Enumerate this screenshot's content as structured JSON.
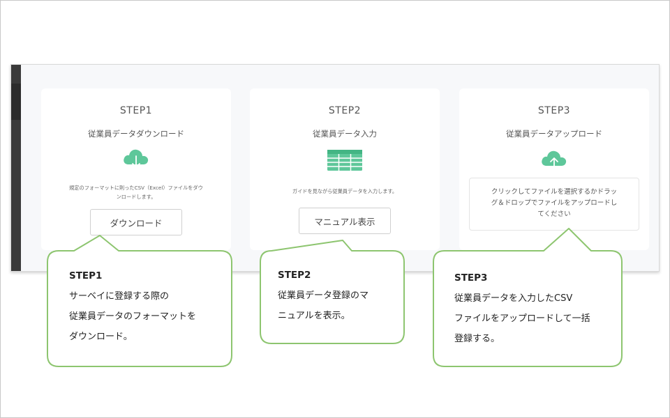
{
  "steps": [
    {
      "title": "STEP1",
      "subtitle": "従業員データダウンロード",
      "icon": "cloud-download-icon",
      "description_lines": [
        "規定のフォーマットに則ったCSV（Excel）ファイルをダウ",
        "ンロードします。"
      ],
      "button_label": "ダウンロード"
    },
    {
      "title": "STEP2",
      "subtitle": "従業員データ入力",
      "icon": "table-icon",
      "description_lines": [
        "ガイドを見ながら従業員データを入力します。"
      ],
      "button_label": "マニュアル表示"
    },
    {
      "title": "STEP3",
      "subtitle": "従業員データアップロード",
      "icon": "cloud-upload-icon",
      "dropzone_lines": [
        "クリックしてファイルを選択するかドラッ",
        "グ＆ドロップでファイルをアップロードし",
        "てください"
      ]
    }
  ],
  "callouts": [
    {
      "heading": "STEP1",
      "lines": [
        "サーベイに登録する際の",
        "従業員データのフォーマットを",
        "ダウンロード。"
      ]
    },
    {
      "heading": "STEP2",
      "lines": [
        "従業員データ登録のマ",
        "ニュアルを表示。"
      ]
    },
    {
      "heading": "STEP3",
      "lines": [
        "従業員データを入力したCSV",
        "ファイルをアップロードして一括",
        "登録する。"
      ]
    }
  ],
  "colors": {
    "icon_green": "#5ec79a",
    "callout_border": "#8dc56f",
    "sidebar": "#3a3a3a",
    "panel_background": "#f7f8fa"
  }
}
